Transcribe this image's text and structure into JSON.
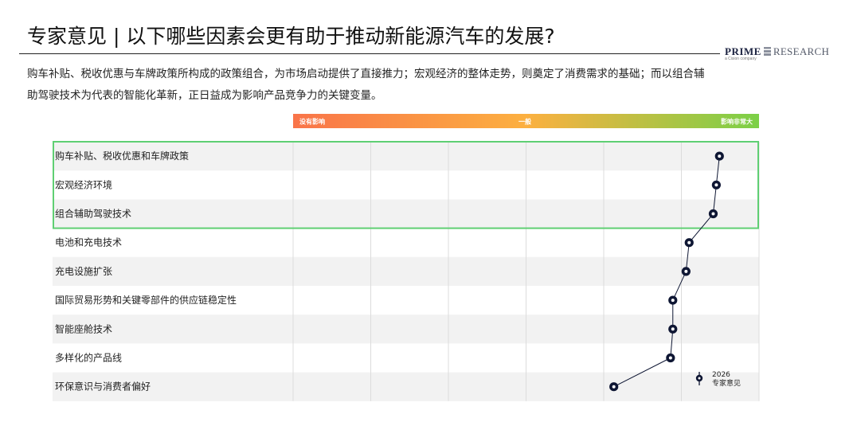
{
  "title": "专家意见 | 以下哪些因素会更有助于推动新能源汽车的发展?",
  "logo": {
    "prime": "PRIME",
    "research": "RESEARCH",
    "sub": "a Cision company"
  },
  "description": "购车补贴、税收优惠与车牌政策所构成的政策组合，为市场启动提供了直接推力；宏观经济的整体走势，则奠定了消费需求的基础；而以组合辅助驾驶技术为代表的智能化革新，正日益成为影响产品竞争力的关键变量。",
  "colors": {
    "scale_start": "#f97449",
    "scale_mid": "#fcb040",
    "scale_end": "#7bd047",
    "highlight": "#5fcf73",
    "point": "#0e1633",
    "row_band": "#f2f2f2"
  },
  "chart_data": {
    "type": "scatter",
    "scale_labels": {
      "low": "没有影响",
      "mid": "一般",
      "high": "影响非常大"
    },
    "xlim": [
      0,
      6
    ],
    "categories": [
      "购车补贴、税收优惠和车牌政策",
      "宏观经济环境",
      "组合辅助驾驶技术",
      "电池和充电技术",
      "充电设施扩张",
      "国际贸易形势和关键零部件的供应链稳定性",
      "智能座舱技术",
      "多样化的产品线",
      "环保意识与消费者偏好"
    ],
    "series": [
      {
        "name": "2026 专家意见",
        "values": [
          5.49,
          5.45,
          5.41,
          5.1,
          5.06,
          4.89,
          4.89,
          4.86,
          4.13
        ]
      }
    ],
    "highlighted": [
      0,
      1,
      2
    ],
    "legend": {
      "year": "2026",
      "label": "专家意见",
      "position": "bottom-right"
    },
    "grid": true
  }
}
